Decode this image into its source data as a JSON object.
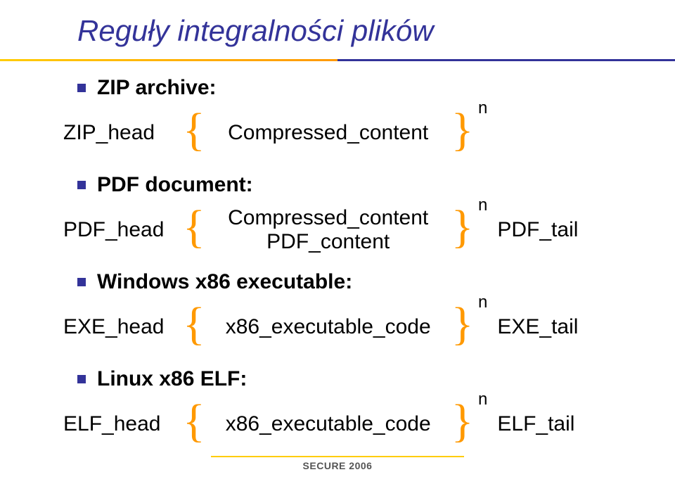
{
  "title": "Reguły integralności plików",
  "sections": {
    "zip": {
      "label": "ZIP archive:",
      "head": "ZIP_head",
      "middle": "Compressed_content",
      "exponent": "n",
      "tail": ""
    },
    "pdf": {
      "label": "PDF document:",
      "head": "PDF_head",
      "middle_top": "Compressed_content",
      "middle_bottom": "PDF_content",
      "exponent": "n",
      "tail": "PDF_tail"
    },
    "exe": {
      "label": "Windows x86 executable:",
      "head": "EXE_head",
      "middle": "x86_executable_code",
      "exponent": "n",
      "tail": "EXE_tail"
    },
    "elf": {
      "label": "Linux x86 ELF:",
      "head": "ELF_head",
      "middle": "x86_executable_code",
      "exponent": "n",
      "tail": "ELF_tail"
    }
  },
  "footer": "SECURE 2006"
}
